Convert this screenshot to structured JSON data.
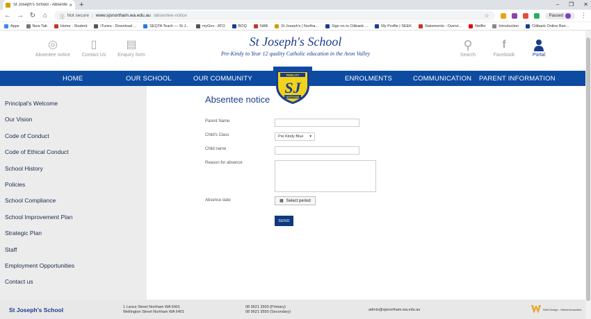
{
  "browser": {
    "tab_title": "St Joseph's School - Absentee n...",
    "new_tab": "+",
    "controls": {
      "minimize": "–",
      "restore": "❐",
      "close": "✕"
    },
    "security_label": "Not secure",
    "url_host": "www.sjsnortham.wa.edu.au",
    "url_path": "/absentee-notice",
    "profile_label": "Paused",
    "bookmarks": [
      {
        "label": "Apps",
        "color": "#4285f4"
      },
      {
        "label": "New Tab",
        "color": "#777"
      },
      {
        "label": "Home - Student",
        "color": "#c0392b"
      },
      {
        "label": "iTunes - Download ...",
        "color": "#555"
      },
      {
        "label": "SEQTA Teach — St J...",
        "color": "#2a7ae2"
      },
      {
        "label": "myGov - ATO",
        "color": "#555"
      },
      {
        "label": "BOQ",
        "color": "#1a3c8f"
      },
      {
        "label": "NAB",
        "color": "#c0392b"
      },
      {
        "label": "St Joseph's | Northa...",
        "color": "#c8a400"
      },
      {
        "label": "Sign on to Citibank ...",
        "color": "#1a3c8f"
      },
      {
        "label": "My Profile | SEEK",
        "color": "#1a3c8f"
      },
      {
        "label": "Statements - Overvi...",
        "color": "#c0392b"
      },
      {
        "label": "Netflix",
        "color": "#e50914"
      },
      {
        "label": "Introduction",
        "color": "#888"
      },
      {
        "label": "Citibank Online Ban...",
        "color": "#1a3c8f"
      }
    ]
  },
  "header": {
    "left_icons": [
      {
        "label": "Absentee notice",
        "icon": "lifebuoy-icon",
        "glyph": "◎"
      },
      {
        "label": "Contact Us",
        "icon": "phone-icon",
        "glyph": "▯"
      },
      {
        "label": "Enquiry form",
        "icon": "document-icon",
        "glyph": "▤"
      }
    ],
    "school_name": "St Joseph's School",
    "tagline": "Pre-Kindy to Year 12 quality Catholic education in the Avon Valley",
    "right_icons": [
      {
        "label": "Search",
        "icon": "search-icon",
        "glyph": "⚲"
      },
      {
        "label": "Facebook",
        "icon": "facebook-icon",
        "glyph": "f"
      },
      {
        "label": "Portal",
        "icon": "user-icon",
        "glyph": "●"
      }
    ]
  },
  "nav": [
    "HOME",
    "OUR SCHOOL",
    "OUR COMMUNITY",
    "ENROLMENTS",
    "COMMUNICATION",
    "PARENT INFORMATION"
  ],
  "crest": {
    "motto": "FIDELITY",
    "letters": "SJ",
    "banner": "NORTHAM"
  },
  "sidebar": [
    "Principal's Welcome",
    "Our Vision",
    "Code of Conduct",
    "Code of Ethical Conduct",
    "School History",
    "Policies",
    "School Compliance",
    "School Improvement Plan",
    "Strategic Plan",
    "Staff",
    "Employment Opportunities",
    "Contact us"
  ],
  "form": {
    "title": "Absentee notice",
    "parent_name_label": "Parent Name",
    "child_class_label": "Child's Class",
    "child_class_value": "Pre Kindy Blue",
    "child_name_label": "Child name",
    "reason_label": "Reason for absence",
    "absence_date_label": "Absence date",
    "select_period": "Select period",
    "send": "SEND"
  },
  "footer": {
    "name": "St Joseph's School",
    "address_1": "1 Lance Street Northam WA 6401",
    "address_2": "Wellington Street Northam WA 6401",
    "phone_1": "08 9621 3500 (Primary)",
    "phone_2": "08 9621 3550 (Secondary)",
    "email": "admin@sjsnortham.wa.edu.au",
    "credit": "Web Design - Webcherusaders"
  }
}
